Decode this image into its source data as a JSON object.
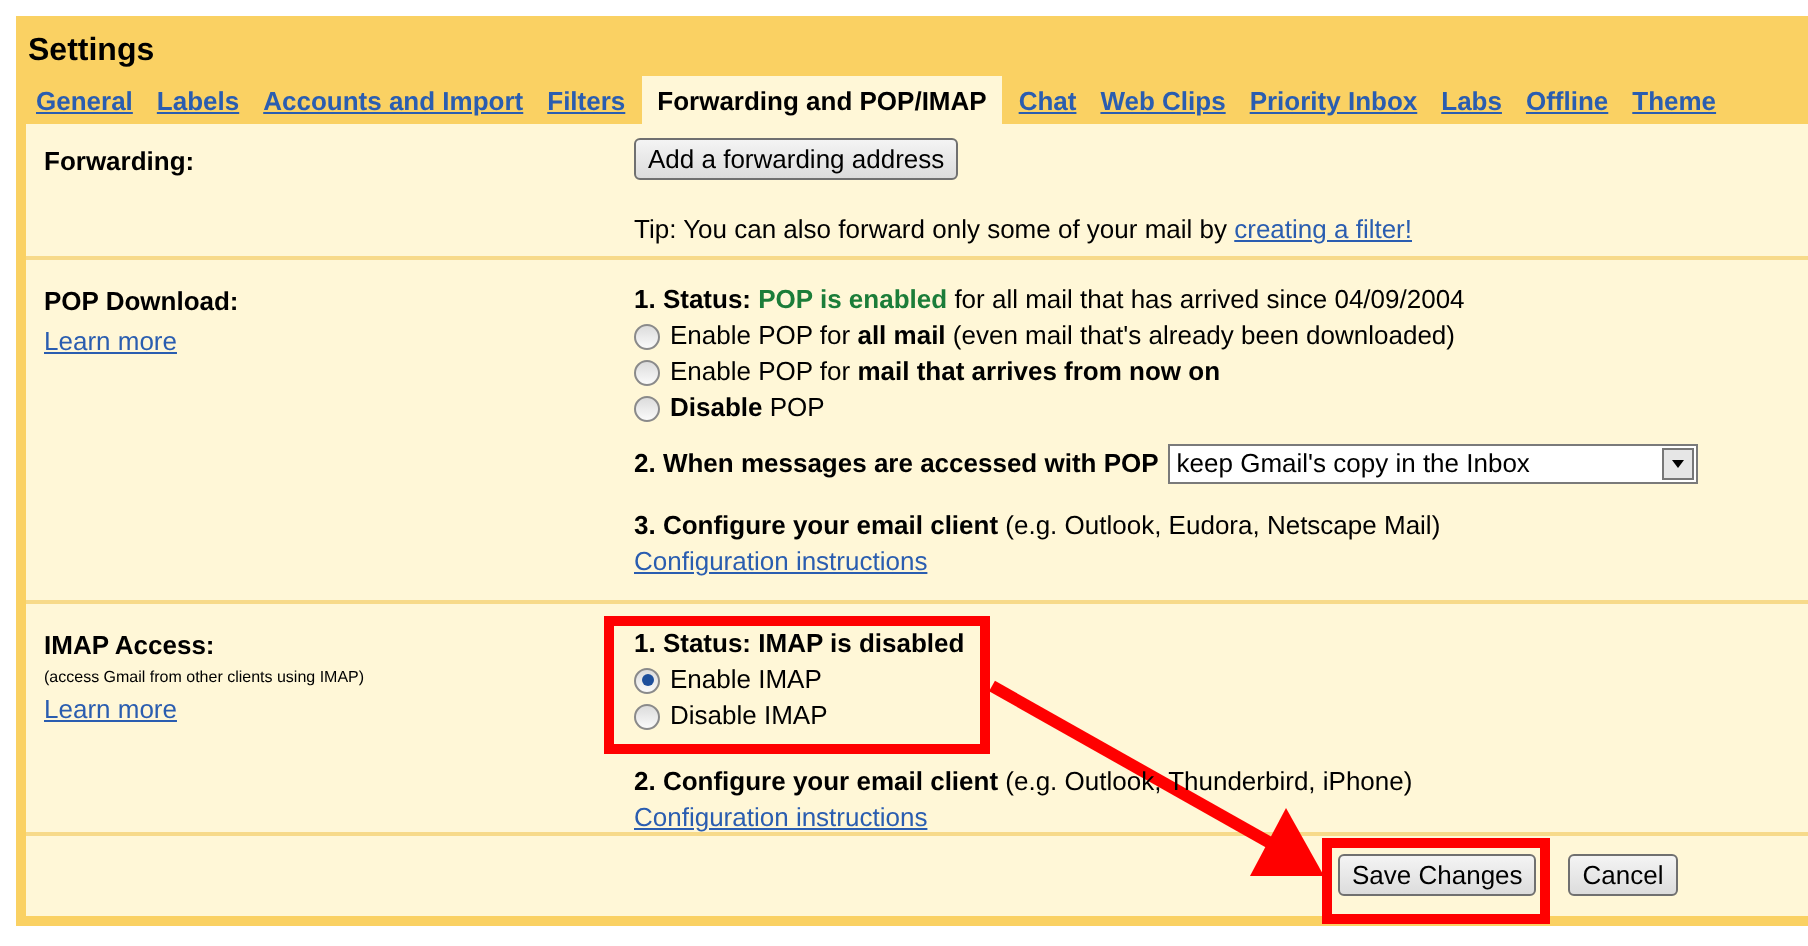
{
  "title": "Settings",
  "tabs": [
    {
      "label": "General",
      "selected": false
    },
    {
      "label": "Labels",
      "selected": false
    },
    {
      "label": "Accounts and Import",
      "selected": false
    },
    {
      "label": "Filters",
      "selected": false
    },
    {
      "label": "Forwarding and POP/IMAP",
      "selected": true
    },
    {
      "label": "Chat",
      "selected": false
    },
    {
      "label": "Web Clips",
      "selected": false
    },
    {
      "label": "Priority Inbox",
      "selected": false
    },
    {
      "label": "Labs",
      "selected": false
    },
    {
      "label": "Offline",
      "selected": false
    },
    {
      "label": "Theme",
      "selected": false
    }
  ],
  "forwarding": {
    "label": "Forwarding:",
    "button": "Add a forwarding address",
    "tip": "Tip: You can also forward only some of your mail by",
    "tip_link": "creating a filter!"
  },
  "pop": {
    "label": "POP Download:",
    "learn_more": "Learn more",
    "status_label": "1. Status:",
    "status_value": "POP is enabled",
    "status_rest": "for all mail that has arrived since 04/09/2004",
    "options": [
      {
        "text": "Enable POP for **all mail** (even mail that's already been downloaded)",
        "selected": false
      },
      {
        "text": "Enable POP for **mail that arrives from now on**",
        "selected": false
      },
      {
        "text": "**Disable** POP",
        "selected": false
      }
    ],
    "access_label": "2. When messages are accessed with POP",
    "access_value": "keep Gmail's copy in the Inbox",
    "configure": "**3. Configure your email client** (e.g. Outlook, Eudora, Netscape Mail)",
    "configure_link": "Configuration instructions"
  },
  "imap": {
    "label": "IMAP Access:",
    "sublabel": "(access Gmail from other clients using IMAP)",
    "learn_more": "Learn more",
    "status": "1. Status: IMAP is disabled",
    "options": [
      {
        "text": "Enable IMAP",
        "selected": true
      },
      {
        "text": "Disable IMAP",
        "selected": false
      }
    ],
    "configure": "**2. Configure your email client** (e.g. Outlook, Thunderbird, iPhone)",
    "configure_link": "Configuration instructions"
  },
  "buttons": {
    "save": "Save Changes",
    "cancel": "Cancel"
  }
}
